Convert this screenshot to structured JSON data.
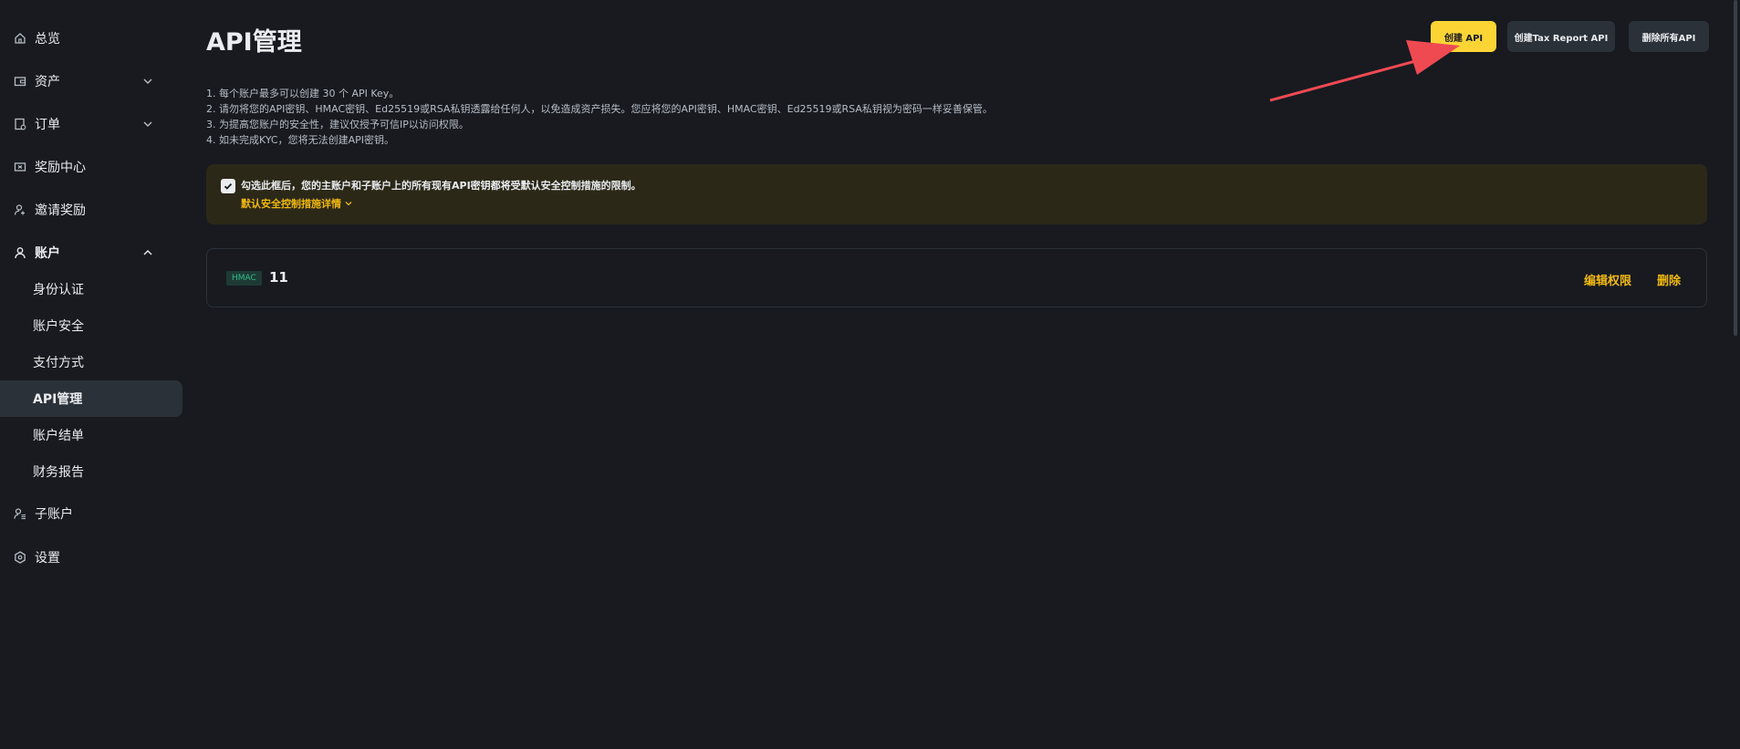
{
  "sidebar": {
    "items": [
      {
        "label": "总览",
        "icon": "home-icon"
      },
      {
        "label": "资产",
        "icon": "wallet-icon",
        "expand": "chevron-down-icon"
      },
      {
        "label": "订单",
        "icon": "order-icon",
        "expand": "chevron-down-icon"
      },
      {
        "label": "奖励中心",
        "icon": "reward-icon"
      },
      {
        "label": "邀请奖励",
        "icon": "invite-user-icon"
      },
      {
        "label": "账户",
        "icon": "user-icon",
        "expand": "chevron-up-icon"
      },
      {
        "label": "子账户",
        "icon": "sub-account-icon"
      },
      {
        "label": "设置",
        "icon": "settings-icon"
      }
    ],
    "account_sub": [
      "身份认证",
      "账户安全",
      "支付方式",
      "API管理",
      "账户结单",
      "财务报告"
    ]
  },
  "page": {
    "title": "API管理",
    "buttons": {
      "create_api": "创建 API",
      "create_tax": "创建Tax Report API",
      "delete_all": "删除所有API"
    },
    "notes": [
      "1. 每个账户最多可以创建 30 个 API Key。",
      "2. 请勿将您的API密钥、HMAC密钥、Ed25519或RSA私钥透露给任何人，以免造成资产损失。您应将您的API密钥、HMAC密钥、Ed25519或RSA私钥视为密码一样妥善保管。",
      "3. 为提高您账户的安全性，建议仅授予可信IP以访问权限。",
      "4. 如未完成KYC，您将无法创建API密钥。"
    ],
    "warning": {
      "text": "勾选此框后，您的主账户和子账户上的所有现有API密钥都将受默认安全控制措施的限制。",
      "link": "默认安全控制措施详情"
    },
    "api_entry": {
      "tag": "HMAC",
      "name": "11",
      "edit": "编辑权限",
      "delete": "删除"
    }
  },
  "colors": {
    "background": "#181a20",
    "accent": "#fcd535",
    "link": "#f0b90b",
    "annotation_arrow": "#ef4a52"
  }
}
